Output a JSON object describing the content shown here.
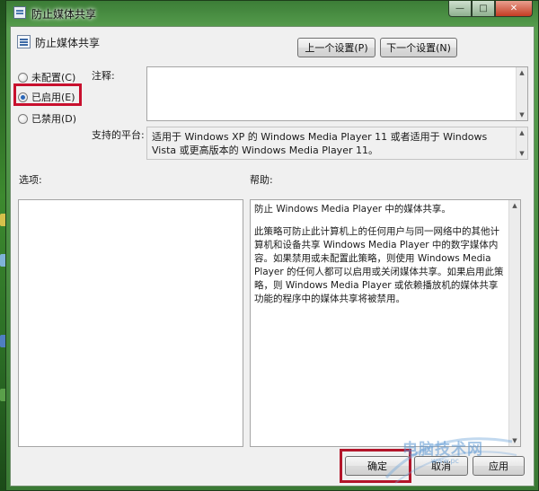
{
  "window": {
    "title": "防止媒体共享"
  },
  "header": {
    "title": "防止媒体共享",
    "prev_label": "上一个设置(P)",
    "next_label": "下一个设置(N)"
  },
  "state": {
    "options": [
      {
        "label": "未配置(C)",
        "checked": false
      },
      {
        "label": "已启用(E)",
        "checked": true
      },
      {
        "label": "已禁用(D)",
        "checked": false
      }
    ]
  },
  "comment": {
    "label": "注释:",
    "value": ""
  },
  "platform": {
    "label": "支持的平台:",
    "text": "适用于 Windows XP 的 Windows Media Player 11 或者适用于 Windows Vista 或更高版本的 Windows Media Player 11。"
  },
  "options_panel": {
    "label": "选项:"
  },
  "help_panel": {
    "label": "帮助:",
    "para1": "防止 Windows Media Player 中的媒体共享。",
    "para2": "此策略可防止此计算机上的任何用户与同一网络中的其他计算机和设备共享 Windows Media Player 中的数字媒体内容。如果禁用或未配置此策略，则使用 Windows Media Player 的任何人都可以启用或关闭媒体共享。如果启用此策略，则 Windows Media Player 或依赖播放机的媒体共享功能的程序中的媒体共享将被禁用。"
  },
  "footer": {
    "ok_label": "确定",
    "cancel_label": "取消",
    "apply_label": "应用"
  },
  "watermark": {
    "text": "电脑技术网",
    "sub": "www.pc"
  },
  "colors": {
    "highlight_box": "#c8102e",
    "desktop_green": "#2f6b2a"
  }
}
